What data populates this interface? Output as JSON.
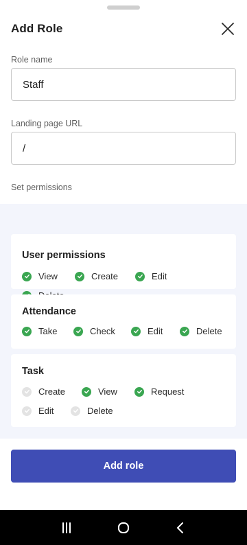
{
  "header": {
    "title": "Add Role"
  },
  "form": {
    "role_name": {
      "label": "Role name",
      "value": "Staff"
    },
    "landing_url": {
      "label": "Landing page URL",
      "value": "/"
    },
    "permissions_label": "Set permissions"
  },
  "permissions": [
    {
      "title": "User permissions",
      "items": [
        {
          "label": "View",
          "checked": true
        },
        {
          "label": "Create",
          "checked": true
        },
        {
          "label": "Edit",
          "checked": true
        },
        {
          "label": "Delete",
          "checked": true
        }
      ]
    },
    {
      "title": "Attendance",
      "items": [
        {
          "label": "Take",
          "checked": true
        },
        {
          "label": "Check",
          "checked": true
        },
        {
          "label": "Edit",
          "checked": true
        },
        {
          "label": "Delete",
          "checked": true
        }
      ]
    },
    {
      "title": "Task",
      "items": [
        {
          "label": "Create",
          "checked": false
        },
        {
          "label": "View",
          "checked": true
        },
        {
          "label": "Request",
          "checked": true
        },
        {
          "label": "Edit",
          "checked": false
        },
        {
          "label": "Delete",
          "checked": false
        }
      ]
    }
  ],
  "actions": {
    "submit_label": "Add role"
  },
  "colors": {
    "accent": "#3f4db5",
    "check_on": "#3aa651",
    "check_off": "#e3e3e3",
    "section_bg": "#f3f5fc"
  },
  "icons": {
    "close": "close-icon",
    "check": "check-circle-icon",
    "nav_recents": "recents-icon",
    "nav_home": "home-icon",
    "nav_back": "back-icon"
  }
}
